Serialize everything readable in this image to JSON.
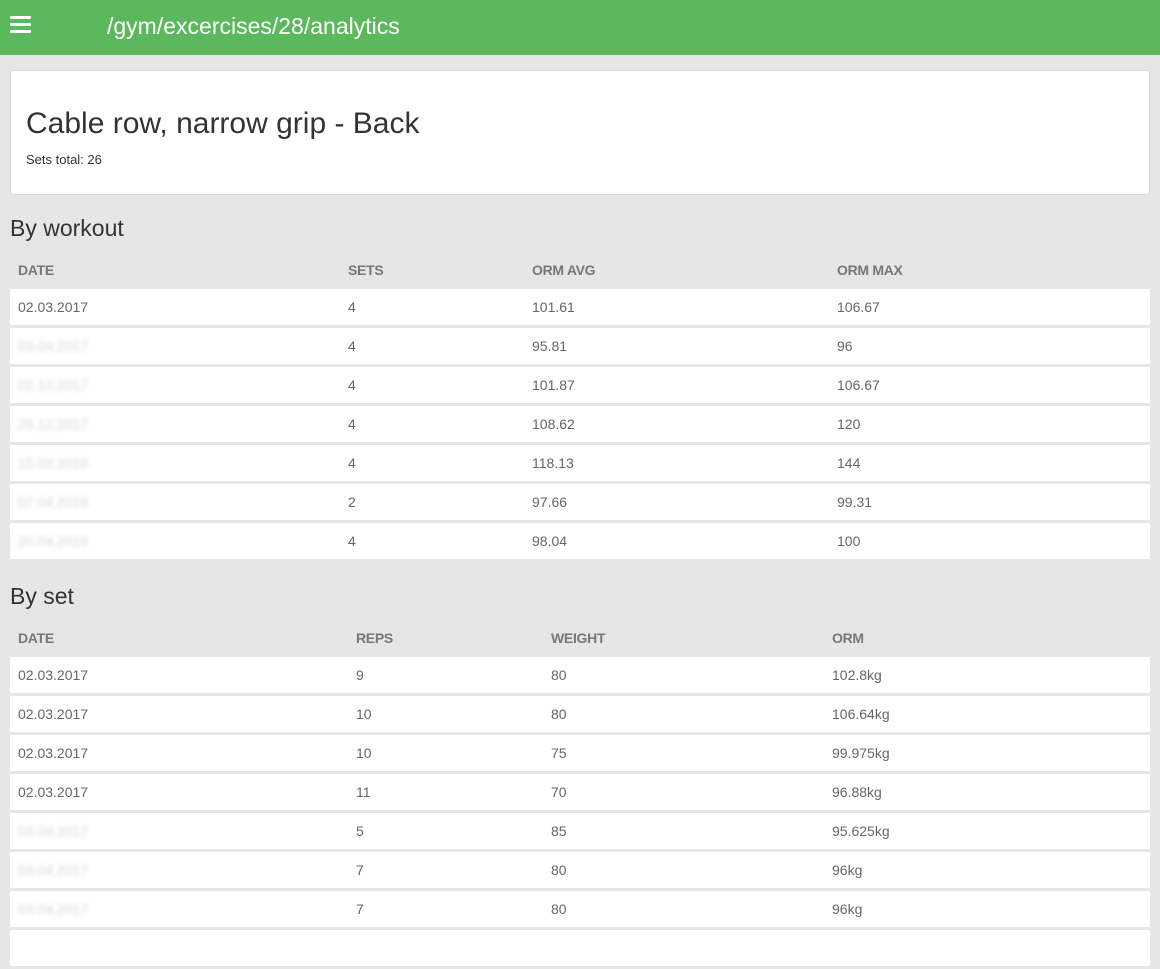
{
  "header": {
    "path": "/gym/excercises/28/analytics"
  },
  "icons": {
    "menu": "hamburger-menu-icon"
  },
  "colors": {
    "topbar": "#5cb85c",
    "background": "#e6e6e6",
    "card": "#ffffff"
  },
  "exercise": {
    "title": "Cable row, narrow grip - Back",
    "sets_total": "Sets total: 26"
  },
  "by_workout": {
    "title": "By workout",
    "columns": [
      "DATE",
      "SETS",
      "ORM AVG",
      "ORM MAX"
    ],
    "rows": [
      {
        "date": "02.03.2017",
        "sets": "4",
        "orm_avg": "101.61",
        "orm_max": "106.67"
      },
      {
        "date": "03.04.2017",
        "sets": "4",
        "orm_avg": "95.81",
        "orm_max": "96"
      },
      {
        "date": "02.12.2017",
        "sets": "4",
        "orm_avg": "101.87",
        "orm_max": "106.67"
      },
      {
        "date": "29.12.2017",
        "sets": "4",
        "orm_avg": "108.62",
        "orm_max": "120"
      },
      {
        "date": "15.02.2018",
        "sets": "4",
        "orm_avg": "118.13",
        "orm_max": "144"
      },
      {
        "date": "07.04.2018",
        "sets": "2",
        "orm_avg": "97.66",
        "orm_max": "99.31"
      },
      {
        "date": "20.04.2018",
        "sets": "4",
        "orm_avg": "98.04",
        "orm_max": "100"
      }
    ]
  },
  "by_set": {
    "title": "By set",
    "columns": [
      "DATE",
      "REPS",
      "WEIGHT",
      "ORM"
    ],
    "rows": [
      {
        "date": "02.03.2017",
        "reps": "9",
        "weight": "80",
        "orm": "102.8kg"
      },
      {
        "date": "02.03.2017",
        "reps": "10",
        "weight": "80",
        "orm": "106.64kg"
      },
      {
        "date": "02.03.2017",
        "reps": "10",
        "weight": "75",
        "orm": "99.975kg"
      },
      {
        "date": "02.03.2017",
        "reps": "11",
        "weight": "70",
        "orm": "96.88kg"
      },
      {
        "date": "03.04.2017",
        "reps": "5",
        "weight": "85",
        "orm": "95.625kg"
      },
      {
        "date": "03.04.2017",
        "reps": "7",
        "weight": "80",
        "orm": "96kg"
      },
      {
        "date": "03.04.2017",
        "reps": "7",
        "weight": "80",
        "orm": "96kg"
      },
      {
        "date": "",
        "reps": "",
        "weight": "",
        "orm": ""
      }
    ]
  }
}
